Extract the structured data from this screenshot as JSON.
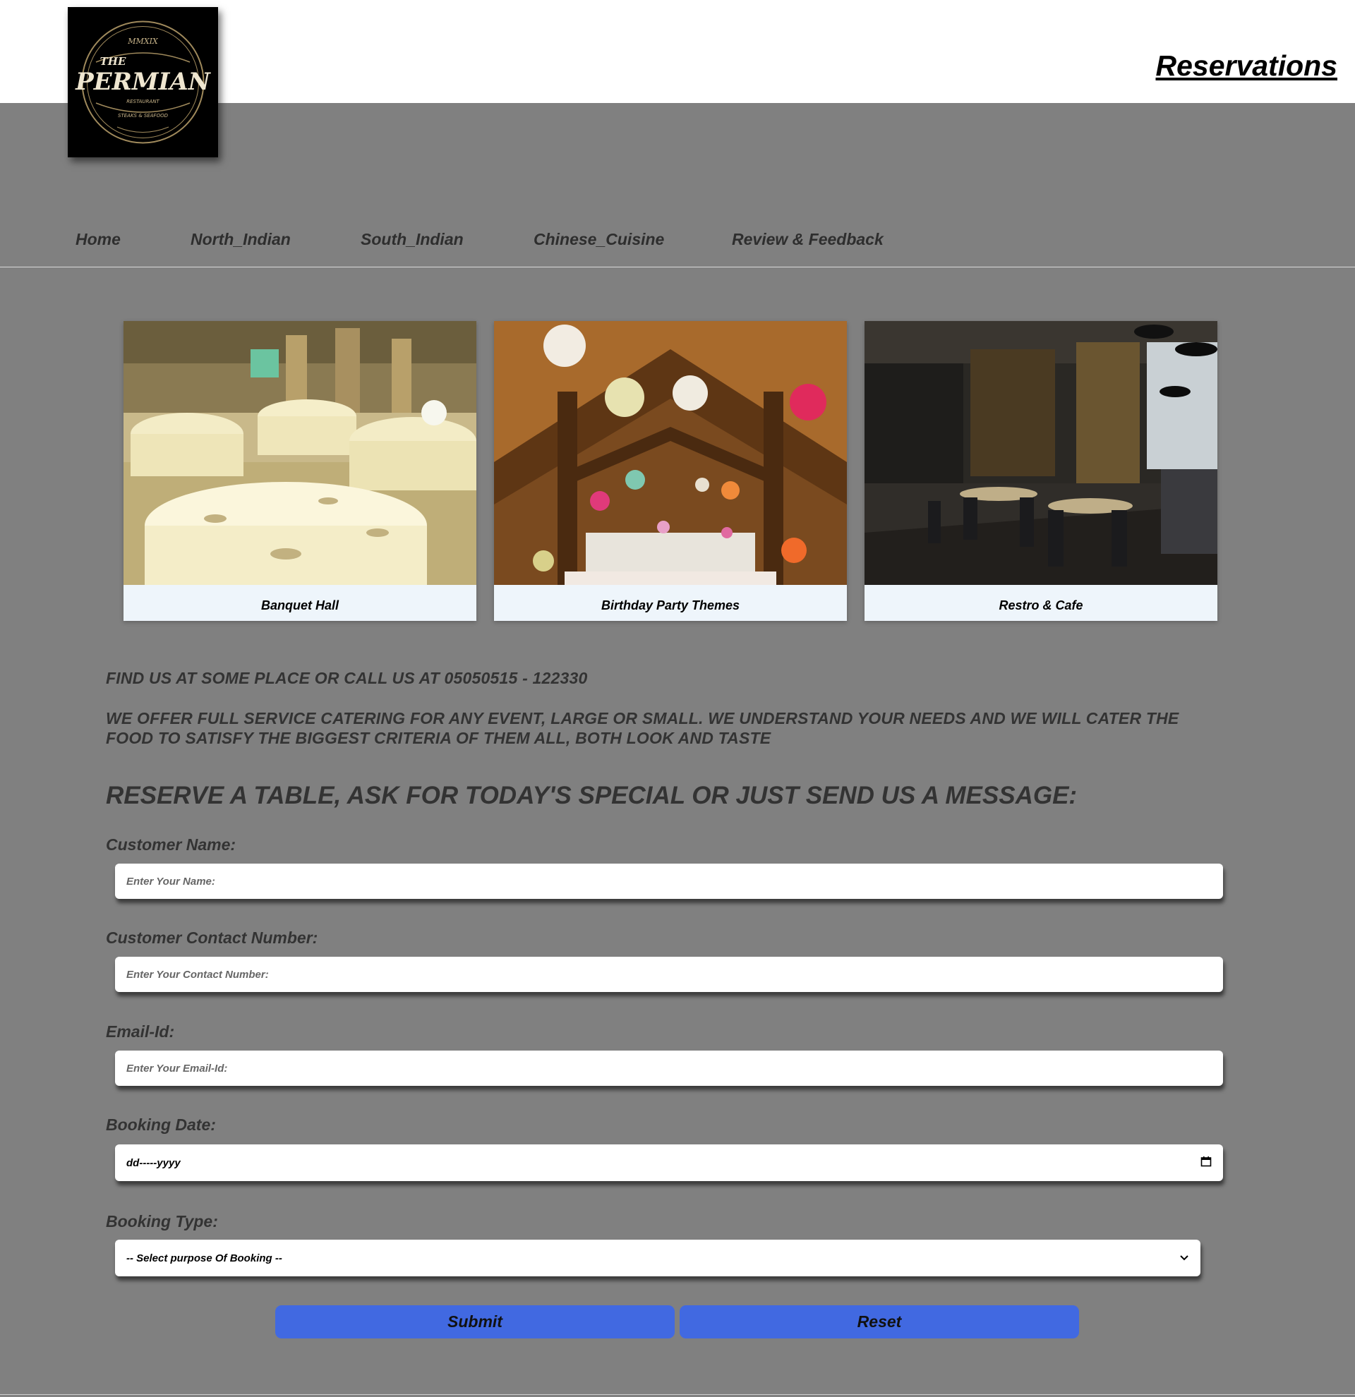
{
  "header": {
    "logo": {
      "top_text": "MMXIX",
      "the": "THE",
      "name": "PERMIAN",
      "ribbon": "RESTAURANT",
      "sub": "STEAKS & SEAFOOD"
    },
    "page_title": "Reservations"
  },
  "nav": [
    {
      "label": "Home"
    },
    {
      "label": "North_Indian"
    },
    {
      "label": "South_Indian"
    },
    {
      "label": "Chinese_Cuisine"
    },
    {
      "label": "Review & Feedback"
    }
  ],
  "gallery": [
    {
      "caption": "Banquet Hall"
    },
    {
      "caption": "Birthday Party Themes"
    },
    {
      "caption": "Restro & Cafe"
    }
  ],
  "info": {
    "contact_line": "FIND US AT SOME PLACE OR CALL US AT 05050515 - 122330",
    "catering_line": "WE OFFER FULL SERVICE CATERING FOR ANY EVENT, LARGE OR SMALL. WE UNDERSTAND YOUR NEEDS AND WE WILL CATER THE FOOD TO SATISFY THE BIGGEST CRITERIA OF THEM ALL, BOTH LOOK AND TASTE"
  },
  "form": {
    "heading": "RESERVE A TABLE, ASK FOR TODAY'S SPECIAL OR JUST SEND US A MESSAGE:",
    "name_label": "Customer Name:",
    "name_placeholder": "Enter Your Name:",
    "contact_label": "Customer Contact Number:",
    "contact_placeholder": "Enter Your Contact Number:",
    "email_label": "Email-Id:",
    "email_placeholder": "Enter Your Email-Id:",
    "date_label": "Booking Date:",
    "date_value": "dd-----yyyy",
    "type_label": "Booking Type:",
    "type_selected": "-- Select purpose Of Booking --",
    "submit_label": "Submit",
    "reset_label": "Reset"
  },
  "colors": {
    "page_background": "#808080",
    "header_background": "#ffffff",
    "button_color": "#4169e1",
    "caption_background": "#eef5fb"
  }
}
